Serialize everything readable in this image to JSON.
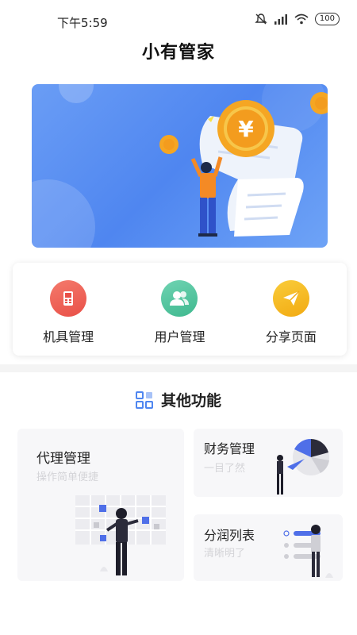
{
  "status": {
    "time": "下午5:59",
    "battery": "100"
  },
  "app": {
    "title": "小有管家"
  },
  "menu": [
    {
      "label": "机具管理",
      "icon": "device-icon",
      "color": "#f0665c"
    },
    {
      "label": "用户管理",
      "icon": "users-icon",
      "color": "#4fc6a0"
    },
    {
      "label": "分享页面",
      "icon": "paper-plane-icon",
      "color": "#f5b821"
    }
  ],
  "section": {
    "title": "其他功能"
  },
  "cards": {
    "agent": {
      "title": "代理管理",
      "subtitle": "操作简单便捷"
    },
    "finance": {
      "title": "财务管理",
      "subtitle": "一目了然"
    },
    "profit": {
      "title": "分润列表",
      "subtitle": "清晰明了"
    }
  },
  "colors": {
    "accent": "#4f86f0",
    "banner": "#5a8ff2"
  }
}
